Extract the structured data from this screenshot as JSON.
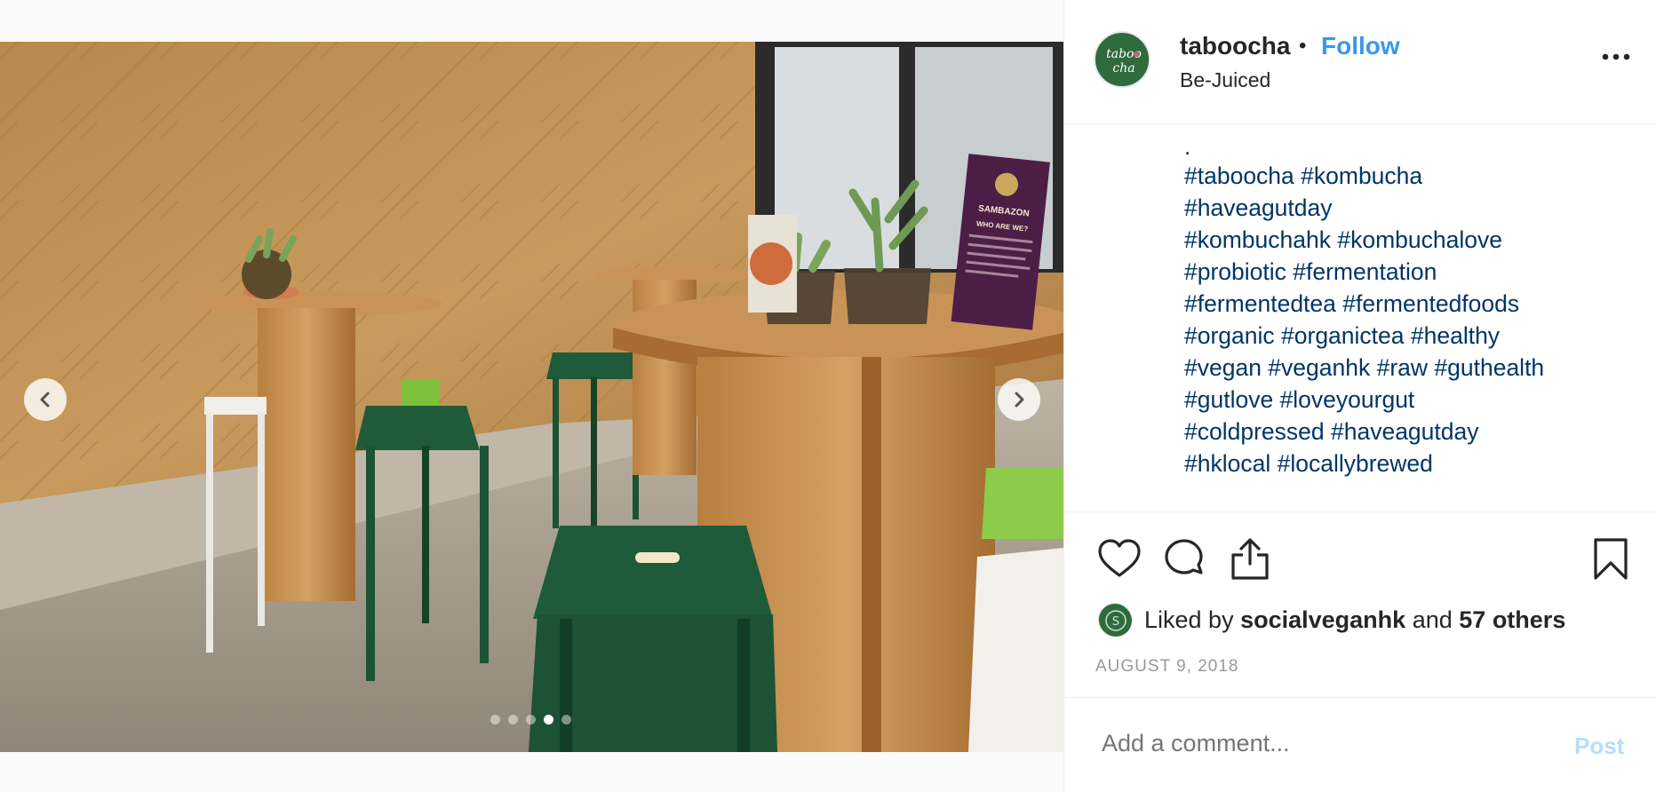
{
  "post": {
    "username": "taboocha",
    "bullet": "•",
    "follow_label": "Follow",
    "location": "Be-Juiced",
    "more_icon": "more-horizontal-icon",
    "avatar_text": "taboo cha"
  },
  "media": {
    "carousel": {
      "slide_count": 5,
      "active_index": 3
    },
    "prev_icon": "chevron-left-icon",
    "next_icon": "chevron-right-icon",
    "sign_text": [
      "SAMBAZON",
      "WHO ARE WE?"
    ]
  },
  "caption": {
    "leading": ".",
    "lines": [
      "#taboocha #kombucha",
      "#haveagutday",
      "#kombuchahk #kombuchalove",
      "#probiotic #fermentation",
      "#fermentedtea #fermentedfoods",
      "#organic #organictea #healthy",
      "#vegan #veganhk #raw #guthealth",
      "#gutlove #loveyourgut",
      "#coldpressed #haveagutday",
      "#hklocal #locallybrewed"
    ]
  },
  "actions": {
    "like_icon": "heart-icon",
    "comment_icon": "comment-icon",
    "share_icon": "share-icon",
    "save_icon": "bookmark-icon"
  },
  "likes": {
    "prefix": "Liked by",
    "user": "socialveganhk",
    "middle": "and",
    "others": "57 others"
  },
  "date": "AUGUST 9, 2018",
  "comment": {
    "placeholder": "Add a comment...",
    "post_label": "Post"
  },
  "colors": {
    "link_blue": "#3897f0",
    "hashtag": "#003569",
    "post_disabled": "#b2dffc",
    "muted": "#999999"
  }
}
